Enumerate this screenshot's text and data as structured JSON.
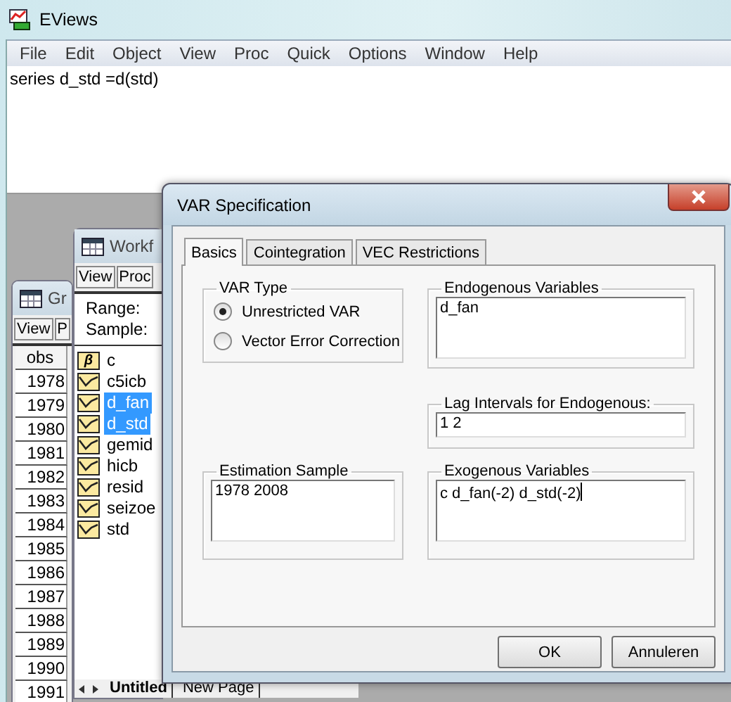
{
  "app": {
    "title": "EViews"
  },
  "menu": [
    "File",
    "Edit",
    "Object",
    "View",
    "Proc",
    "Quick",
    "Options",
    "Window",
    "Help"
  ],
  "command": "series d_std =d(std)",
  "group_window": {
    "title": "Gr",
    "toolbar": [
      "View",
      "P"
    ],
    "column": "obs",
    "rows": [
      "1978",
      "1979",
      "1980",
      "1981",
      "1982",
      "1983",
      "1984",
      "1985",
      "1986",
      "1987",
      "1988",
      "1989",
      "1990",
      "1991"
    ]
  },
  "workfile_window": {
    "title": "Workf",
    "toolbar": [
      "View",
      "Proc"
    ],
    "range_label": "Range:",
    "sample_label": "Sample:",
    "objects": [
      {
        "name": "c",
        "kind": "coef",
        "glyph": "β",
        "selected": false
      },
      {
        "name": "c5icb",
        "kind": "series",
        "selected": false
      },
      {
        "name": "d_fan",
        "kind": "series",
        "selected": true
      },
      {
        "name": "d_std",
        "kind": "series",
        "selected": true
      },
      {
        "name": "gemid",
        "kind": "series",
        "selected": false
      },
      {
        "name": "hicb",
        "kind": "series",
        "selected": false
      },
      {
        "name": "resid",
        "kind": "series",
        "selected": false
      },
      {
        "name": "seizoe",
        "kind": "series",
        "selected": false
      },
      {
        "name": "std",
        "kind": "series",
        "selected": false
      }
    ],
    "page_tabs": [
      {
        "label": "Untitled",
        "selected": true
      },
      {
        "label": "New Page",
        "selected": false
      }
    ]
  },
  "dialog": {
    "title": "VAR Specification",
    "tabs": [
      {
        "label": "Basics",
        "selected": true
      },
      {
        "label": "Cointegration",
        "selected": false
      },
      {
        "label": "VEC Restrictions",
        "selected": false
      }
    ],
    "var_type": {
      "label": "VAR Type",
      "options": [
        {
          "label": "Unrestricted VAR",
          "selected": true
        },
        {
          "label": "Vector Error Correction",
          "selected": false
        }
      ]
    },
    "endogenous": {
      "label": "Endogenous Variables",
      "value": "d_fan"
    },
    "lag_intervals": {
      "label": "Lag Intervals for Endogenous:",
      "value": "1 2"
    },
    "estimation_sample": {
      "label": "Estimation Sample",
      "value": "1978 2008"
    },
    "exogenous": {
      "label": "Exogenous Variables",
      "value": "c d_fan(-2) d_std(-2)",
      "focused": true
    },
    "buttons": [
      "OK",
      "Annuleren"
    ]
  }
}
